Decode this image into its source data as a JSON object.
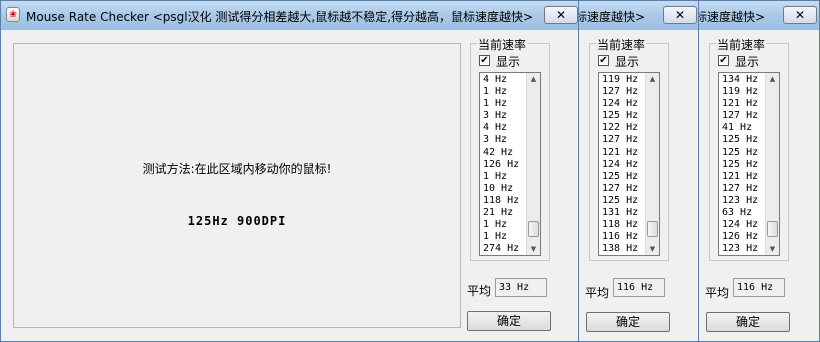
{
  "window1": {
    "title": "Mouse Rate Checker <psgl汉化  测试得分相差越大,鼠标越不稳定,得分越高，鼠标速度越快>",
    "close": "✕",
    "instruction": "测试方法:在此区域内移动你的鼠标!",
    "result": "125Hz 900DPI",
    "group_label": "当前速率",
    "show_label": "显示",
    "list": [
      "4 Hz",
      "1 Hz",
      "1 Hz",
      "3 Hz",
      "4 Hz",
      "3 Hz",
      "42 Hz",
      "126 Hz",
      "1 Hz",
      "10 Hz",
      "118 Hz",
      "21 Hz",
      "1 Hz",
      "1 Hz",
      "274 Hz"
    ],
    "avg_label": "平均",
    "avg_value": "33 Hz",
    "ok": "确定"
  },
  "window2": {
    "title": "标速度越快>",
    "close": "✕",
    "group_label": "当前速率",
    "show_label": "显示",
    "list": [
      "119 Hz",
      "127 Hz",
      "124 Hz",
      "125 Hz",
      "122 Hz",
      "127 Hz",
      "121 Hz",
      "124 Hz",
      "125 Hz",
      "127 Hz",
      "125 Hz",
      "131 Hz",
      "118 Hz",
      "116 Hz",
      "138 Hz"
    ],
    "avg_label": "平均",
    "avg_value": "116 Hz",
    "ok": "确定"
  },
  "window3": {
    "title": "标速度越快>",
    "close": "✕",
    "group_label": "当前速率",
    "show_label": "显示",
    "list": [
      "134 Hz",
      "119 Hz",
      "121 Hz",
      "127 Hz",
      "41 Hz",
      "125 Hz",
      "125 Hz",
      "125 Hz",
      "121 Hz",
      "127 Hz",
      "123 Hz",
      "63 Hz",
      "124 Hz",
      "126 Hz",
      "123 Hz"
    ],
    "avg_label": "平均",
    "avg_value": "116 Hz",
    "ok": "确定"
  },
  "colors": {
    "titlebar": "#a9c8e8",
    "window_bg": "#f0f0f0",
    "list_bg": "#ffffff"
  }
}
